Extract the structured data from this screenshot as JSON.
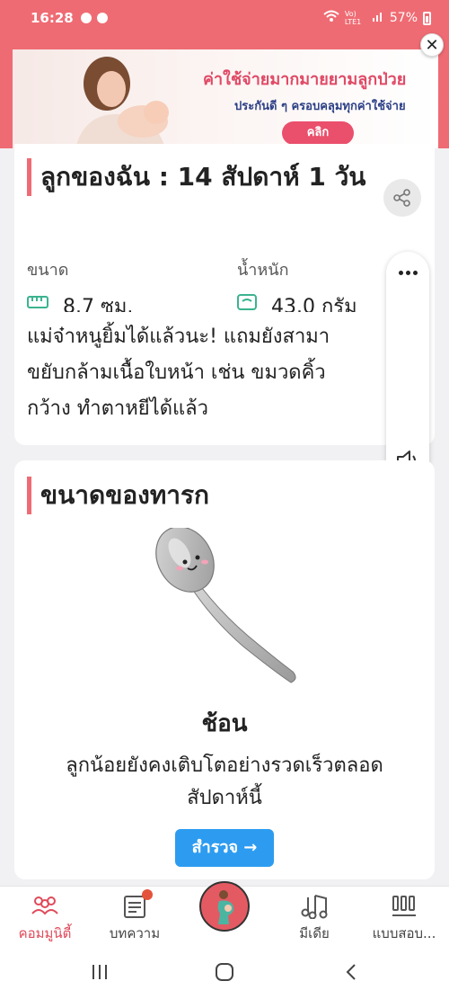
{
  "status_bar": {
    "time": "16:28",
    "carrier": "Vo) LTE1",
    "battery": "57%"
  },
  "ad": {
    "title": "ค่าใช้จ่ายมากมายยามลูกป่วย",
    "subtitle": "ประกันดี ๆ ครอบคลุมทุกค่าใช้จ่าย",
    "button": "คลิก"
  },
  "baby_card": {
    "title": "ลูกของฉัน : 14 สัปดาห์ 1 วัน",
    "size_label": "ขนาด",
    "size_value": "8.7 ซม.",
    "weight_label": "น้ำหนัก",
    "weight_value": "43.0 กรัม",
    "description_lines": [
      "แม่จ๋าหนูยิ้มได้แล้วนะ! แถมยังสามา",
      "ขยับกล้ามเนื้อใบหน้า เช่น ขมวดคิ้ว",
      "กว้าง ทำตาหยีได้แล้ว"
    ]
  },
  "size_card": {
    "title": "ขนาดของทารก",
    "fruit_name": "ช้อน",
    "description_lines": [
      "ลูกน้อยยังคงเติบโตอย่างรวดเร็วตลอด",
      "สัปดาห์นี้"
    ],
    "explore_button": "สำรวจ →"
  },
  "bottom_nav": {
    "items": [
      {
        "label": "คอมมูนิตี้",
        "icon": "community-icon",
        "active": true
      },
      {
        "label": "บทความ",
        "icon": "article-icon",
        "active": false
      },
      {
        "label": "",
        "icon": "pregnancy-icon",
        "active": false
      },
      {
        "label": "มีเดีย",
        "icon": "music-icon",
        "active": false
      },
      {
        "label": "แบบสอบ...",
        "icon": "quiz-icon",
        "active": false
      }
    ]
  },
  "colors": {
    "brand": "#ef6b73",
    "accent_blue": "#2d9cf0",
    "size_icon": "#3bb38f"
  }
}
